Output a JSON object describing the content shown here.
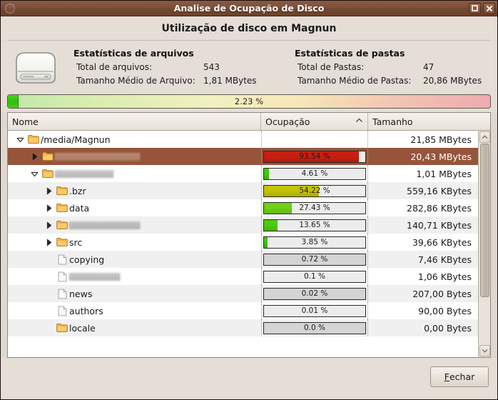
{
  "window": {
    "title": "Analise de Ocupação de Disco",
    "menu_icon": "window-menu-icon",
    "maximize_icon": "maximize-icon",
    "close_icon": "close-icon",
    "titlebar_color": "#7d503b"
  },
  "heading": "Utilização de disco em Magnun",
  "disk_icon": "hard-disk-icon",
  "stats": {
    "files": {
      "title": "Estatísticas de arquivos",
      "rows": [
        {
          "label": "Total de arquivos:",
          "value": "543"
        },
        {
          "label": "Tamanho Médio de Arquivo:",
          "value": "1,81 MBytes"
        }
      ]
    },
    "folders": {
      "title": "Estatísticas de pastas",
      "rows": [
        {
          "label": "Total de Pastas:",
          "value": "47"
        },
        {
          "label": "Tamanho Médio de Pastas:",
          "value": "20,86 MBytes"
        }
      ]
    }
  },
  "overall": {
    "label": "2.23 %",
    "percent": 2.23,
    "fill_color": "#2fbf08"
  },
  "tree": {
    "columns": [
      {
        "key": "name",
        "label": "Nome"
      },
      {
        "key": "occupation",
        "label": "Ocupação",
        "sorted": "asc",
        "sort_icon": "chevron-up-icon"
      },
      {
        "key": "size",
        "label": "Tamanho"
      }
    ],
    "rows": [
      {
        "name": "/media/Magnun",
        "redacted": false,
        "icon": "folder-icon",
        "expander": "triangle-down-icon",
        "depth": 0,
        "percent_label": "",
        "percent": null,
        "bar": "none",
        "size": "21,85 MBytes",
        "selected": false
      },
      {
        "name": "",
        "redacted": true,
        "redacted_width": 120,
        "icon": "folder-icon",
        "expander": "triangle-right-icon",
        "depth": 1,
        "percent_label": "93.54 %",
        "percent": 93.54,
        "bar_color": "#c81f12",
        "size": "20,43 MBytes",
        "selected": true
      },
      {
        "name": "",
        "redacted": true,
        "redacted_width": 82,
        "icon": "folder-icon",
        "expander": "triangle-down-icon",
        "depth": 1,
        "percent_label": "4.61 %",
        "percent": 4.61,
        "bar_color": "#3ec80f",
        "size": "1,01 MBytes",
        "selected": false
      },
      {
        "name": ".bzr",
        "redacted": false,
        "icon": "folder-icon",
        "expander": "triangle-right-icon",
        "depth": 2,
        "percent_label": "54.22 %",
        "percent": 54.22,
        "bar_color": "#c5c400",
        "size": "559,16 KBytes",
        "selected": false
      },
      {
        "name": "data",
        "redacted": false,
        "icon": "folder-icon",
        "expander": "triangle-right-icon",
        "depth": 2,
        "percent_label": "27.43 %",
        "percent": 27.43,
        "bar_color": "#6fd215",
        "size": "282,86 KBytes",
        "selected": false
      },
      {
        "name": "",
        "redacted": true,
        "redacted_width": 100,
        "icon": "folder-icon",
        "expander": "triangle-right-icon",
        "depth": 2,
        "percent_label": "13.65 %",
        "percent": 13.65,
        "bar_color": "#4ecb10",
        "size": "140,71 KBytes",
        "selected": false
      },
      {
        "name": "src",
        "redacted": false,
        "icon": "folder-icon",
        "expander": "triangle-right-icon",
        "depth": 2,
        "percent_label": "3.85 %",
        "percent": 3.85,
        "bar_color": "#3ec80f",
        "size": "39,66 KBytes",
        "selected": false
      },
      {
        "name": "copying",
        "redacted": false,
        "icon": "file-icon",
        "expander": "none",
        "depth": 2,
        "percent_label": "0.72 %",
        "percent": 0.72,
        "bar": "flat-dark",
        "size": "7,46 KBytes",
        "selected": false
      },
      {
        "name": "",
        "redacted": true,
        "redacted_width": 72,
        "icon": "file-icon",
        "expander": "none",
        "depth": 2,
        "percent_label": "0.1 %",
        "percent": 0.1,
        "bar": "flat-light",
        "size": "1,06 KBytes",
        "selected": false
      },
      {
        "name": "news",
        "redacted": false,
        "icon": "file-icon",
        "expander": "none",
        "depth": 2,
        "percent_label": "0.02 %",
        "percent": 0.02,
        "bar": "flat-dark",
        "size": "207,00 Bytes",
        "selected": false
      },
      {
        "name": "authors",
        "redacted": false,
        "icon": "file-icon",
        "expander": "none",
        "depth": 2,
        "percent_label": "0.01 %",
        "percent": 0.01,
        "bar": "flat-light",
        "size": "90,00 Bytes",
        "selected": false
      },
      {
        "name": "locale",
        "redacted": false,
        "icon": "folder-icon",
        "expander": "none",
        "depth": 2,
        "percent_label": "0.0 %",
        "percent": 0,
        "bar": "flat-dark",
        "size": "0,00 Bytes",
        "selected": false
      }
    ]
  },
  "scrollbar": {
    "up_icon": "scroll-up-icon",
    "down_icon": "scroll-down-icon"
  },
  "footer": {
    "close_button": {
      "mnemonic": "F",
      "rest": "echar"
    }
  }
}
